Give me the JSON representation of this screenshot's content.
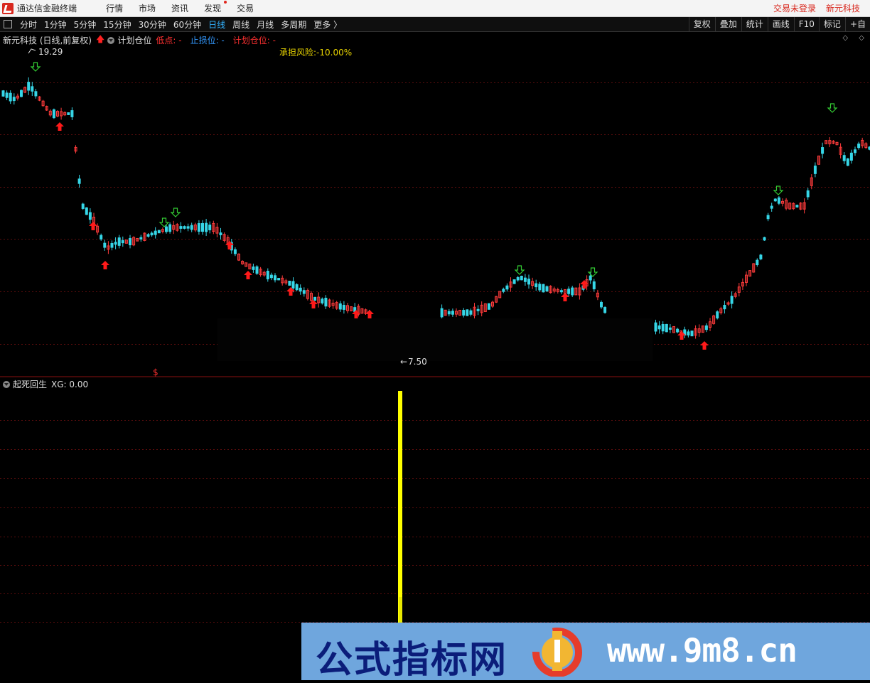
{
  "menubar": {
    "app_title": "通达信金融终端",
    "items": [
      "行情",
      "市场",
      "资讯",
      "发现",
      "交易"
    ],
    "login_status": "交易未登录",
    "stock_name": "新元科技"
  },
  "toolbar": {
    "periods": [
      "分时",
      "1分钟",
      "5分钟",
      "15分钟",
      "30分钟",
      "60分钟",
      "日线",
      "周线",
      "月线",
      "多周期",
      "更多 〉"
    ],
    "active_period": "日线",
    "right_buttons": [
      "复权",
      "叠加",
      "统计",
      "画线",
      "F10",
      "标记",
      "+自"
    ]
  },
  "main_chart": {
    "title": "新元科技 (日线,前复权)",
    "indicator_name": "计划仓位",
    "low_label": "低点: -",
    "stop_label": "止损位: -",
    "plan_label": "计划仓位: -",
    "risk_label": "承担风险:-10.00%",
    "high_price": "19.29",
    "low_price_fragment": "7.50",
    "dollar_marker": "$",
    "colors": {
      "up": "#ff3b3b",
      "down": "#36d6e7",
      "buy": "#ff1a1a",
      "sell": "#33cc33",
      "risk": "#e6d200"
    }
  },
  "sub_chart": {
    "indicator": "起死回生",
    "value_label": "XG: 0.00",
    "bar_color": "#ffff00"
  },
  "watermark": {
    "left_text": "公式指标网",
    "right_text": "www.9m8.cn"
  }
}
